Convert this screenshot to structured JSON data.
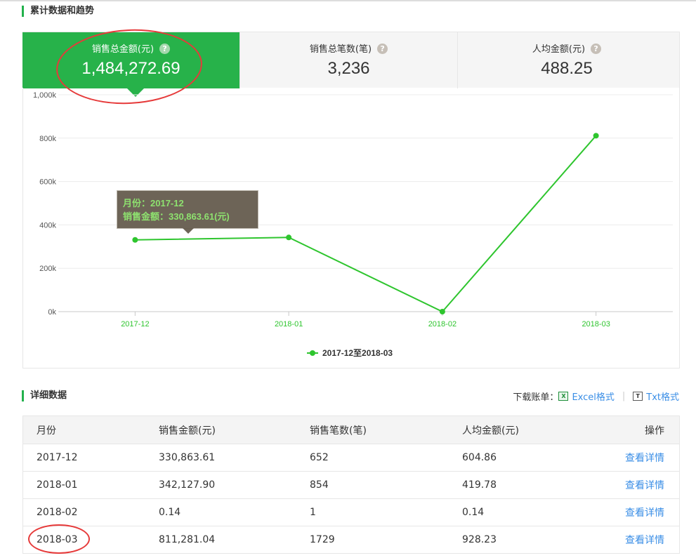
{
  "sections": {
    "cumulative": "累计数据和趋势",
    "details": "详细数据"
  },
  "cards": [
    {
      "label": "销售总金额(元)",
      "value": "1,484,272.69",
      "active": true
    },
    {
      "label": "销售总笔数(笔)",
      "value": "3,236",
      "active": false
    },
    {
      "label": "人均金额(元)",
      "value": "488.25",
      "active": false
    }
  ],
  "help_glyph": "?",
  "chart_data": {
    "type": "line",
    "categories": [
      "2017-12",
      "2018-01",
      "2018-02",
      "2018-03"
    ],
    "series": [
      {
        "name": "2017-12至2018-03",
        "values": [
          330863.61,
          342127.9,
          0.14,
          811281.04
        ]
      }
    ],
    "y_ticks": [
      "0k",
      "200k",
      "400k",
      "600k",
      "800k",
      "1,000k"
    ],
    "ylim": [
      0,
      1000000
    ],
    "grid": true,
    "legend_position": "bottom",
    "color": "#2ec52e"
  },
  "tooltip": {
    "line1": "月份：2017-12",
    "line2": "销售金额：330,863.61(元)"
  },
  "downloads": {
    "label": "下载账单：",
    "excel": "Excel格式",
    "txt": "Txt格式",
    "excel_icon": "excel-file-icon",
    "txt_icon": "txt-file-icon"
  },
  "table": {
    "headers": [
      "月份",
      "销售金额(元)",
      "销售笔数(笔)",
      "人均金额(元)",
      "操作"
    ],
    "rows": [
      [
        "2017-12",
        "330,863.61",
        "652",
        "604.86",
        "查看详情"
      ],
      [
        "2018-01",
        "342,127.90",
        "854",
        "419.78",
        "查看详情"
      ],
      [
        "2018-02",
        "0.14",
        "1",
        "0.14",
        "查看详情"
      ],
      [
        "2018-03",
        "811,281.04",
        "1729",
        "928.23",
        "查看详情"
      ]
    ]
  },
  "colors": {
    "accent": "#27b24a",
    "line": "#2ec52e",
    "link": "#3a8ee6",
    "annotation": "#e63a3a"
  }
}
